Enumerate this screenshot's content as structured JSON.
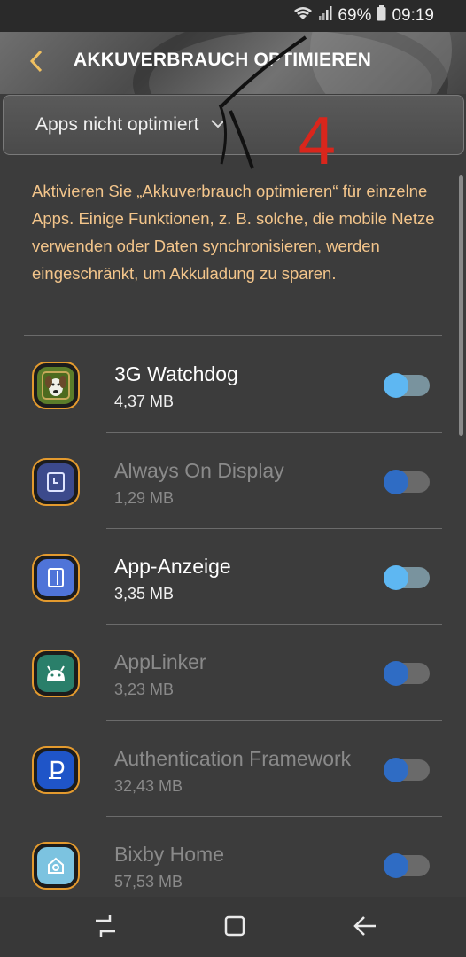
{
  "status_bar": {
    "battery": "69%",
    "time": "09:19",
    "icons": [
      "wifi-icon",
      "signal-icon",
      "battery-icon"
    ]
  },
  "header": {
    "title": "AKKUVERBRAUCH OPTIMIEREN",
    "back_icon": "back-arrow-icon"
  },
  "filter": {
    "selected": "Apps nicht optimiert"
  },
  "annotation": {
    "number": "4"
  },
  "description": "Aktivieren Sie „Akkuverbrauch optimieren“ für einzelne Apps. Einige Funktionen, z. B. solche, die mobile Netze verwenden oder Daten synchronisieren, werden eingeschränkt, um Akkuladung zu sparen.",
  "apps": [
    {
      "name": "3G Watchdog",
      "size": "4,37 MB",
      "state": "on",
      "icon": "watchdog-dog-icon"
    },
    {
      "name": "Always On Display",
      "size": "1,29 MB",
      "state": "off",
      "icon": "always-on-display-icon"
    },
    {
      "name": "App-Anzeige",
      "size": "3,35 MB",
      "state": "on",
      "icon": "app-anzeige-icon"
    },
    {
      "name": "AppLinker",
      "size": "3,23 MB",
      "state": "off",
      "icon": "android-icon"
    },
    {
      "name": "Authentication Framework",
      "size": "32,43 MB",
      "state": "off",
      "icon": "samsung-pass-icon"
    },
    {
      "name": "Bixby Home",
      "size": "57,53 MB",
      "state": "off",
      "icon": "bixby-home-icon"
    }
  ],
  "navbar": {
    "buttons": [
      "recents-icon",
      "home-icon",
      "back-icon"
    ]
  },
  "colors": {
    "background": "#3c3c3c",
    "description_text": "#f3c58b",
    "toggle_on_knob": "#5eb7f2",
    "toggle_off_knob": "#2f6cc4",
    "icon_border": "#e39a2e",
    "annotation_red": "#d9261c"
  }
}
